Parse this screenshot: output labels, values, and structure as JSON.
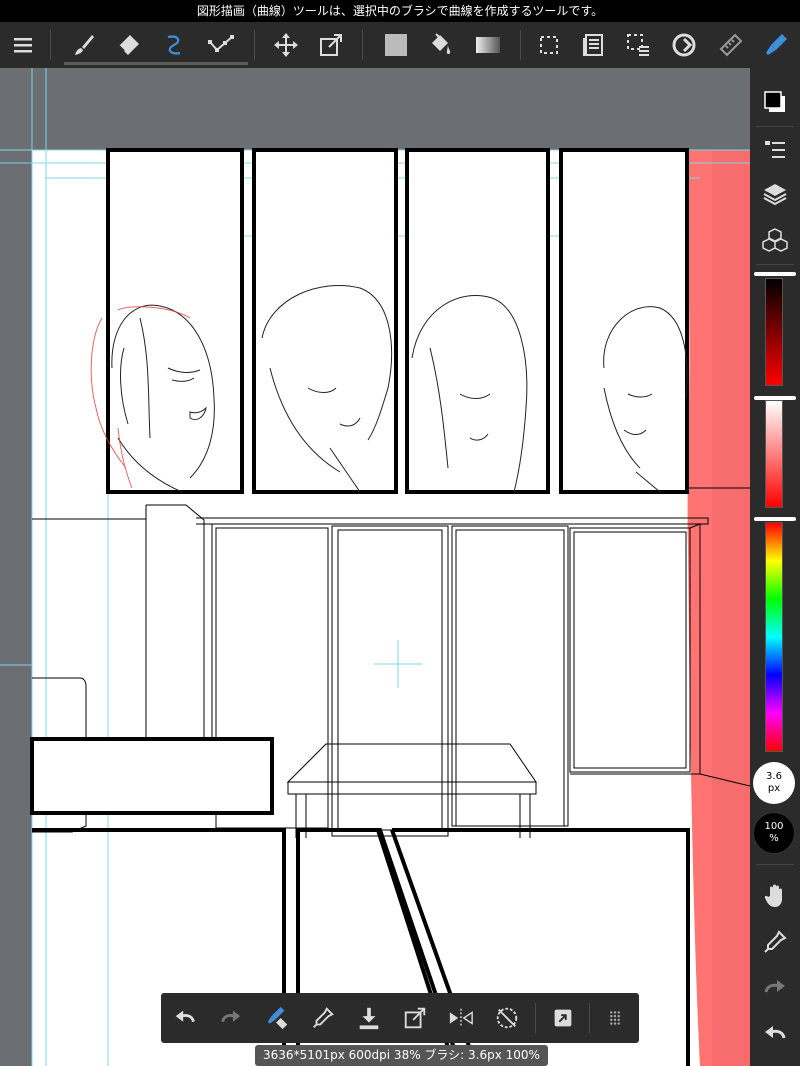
{
  "status_bar": {
    "message": "図形描画（曲線）ツールは、選択中のブラシで曲線を作成するツールです。"
  },
  "toolbar": {
    "items": [
      {
        "id": "menu",
        "icon": "menu-icon"
      },
      {
        "id": "brush",
        "icon": "brush-icon",
        "selected": true
      },
      {
        "id": "eraser",
        "icon": "eraser-icon"
      },
      {
        "id": "curve",
        "icon": "curve-icon",
        "active": true
      },
      {
        "id": "dot-line",
        "icon": "polyline-icon"
      },
      {
        "id": "move",
        "icon": "move-icon"
      },
      {
        "id": "transform",
        "icon": "transform-icon"
      },
      {
        "id": "fill-color",
        "icon": "fill-square-icon"
      },
      {
        "id": "bucket",
        "icon": "bucket-icon"
      },
      {
        "id": "gradient",
        "icon": "gradient-icon"
      },
      {
        "id": "select",
        "icon": "select-icon"
      },
      {
        "id": "text",
        "icon": "text-icon"
      },
      {
        "id": "select-pen",
        "icon": "select-pen-icon"
      },
      {
        "id": "rotate",
        "icon": "rotate-icon"
      },
      {
        "id": "ruler",
        "icon": "ruler-icon"
      },
      {
        "id": "pen-settings",
        "icon": "pen-icon"
      }
    ]
  },
  "sidebar": {
    "brush_size_value": "3.6",
    "brush_size_unit": "px",
    "opacity_value": "100",
    "opacity_unit": "%",
    "sliders": {
      "value_level": 1.0,
      "saturation_level": 0.06,
      "hue_level": 0.0
    }
  },
  "bottom_bar": {
    "items": [
      {
        "id": "undo",
        "icon": "undo-icon"
      },
      {
        "id": "redo",
        "icon": "redo-icon"
      },
      {
        "id": "brush-eraser-toggle",
        "icon": "brush-eraser-icon"
      },
      {
        "id": "eyedropper",
        "icon": "eyedropper-icon"
      },
      {
        "id": "save",
        "icon": "download-icon"
      },
      {
        "id": "export",
        "icon": "export-icon"
      },
      {
        "id": "flip",
        "icon": "flip-icon"
      },
      {
        "id": "rotate-reset",
        "icon": "rotate-reset-icon"
      },
      {
        "id": "quick-action",
        "icon": "quick-action-icon"
      },
      {
        "id": "more",
        "icon": "grid-dots-icon"
      }
    ]
  },
  "info_bar": {
    "text": "3636*5101px 600dpi 38% ブラシ: 3.6px 100%"
  },
  "colors": {
    "toolbar_bg": "#2b2b2b",
    "canvas_bg": "#6b6e72",
    "accent_blue": "#3d8fd8",
    "guide_cyan": "#7fd8e0",
    "highlight_red": "#ff6b6b",
    "current_color": "#ff0000"
  }
}
